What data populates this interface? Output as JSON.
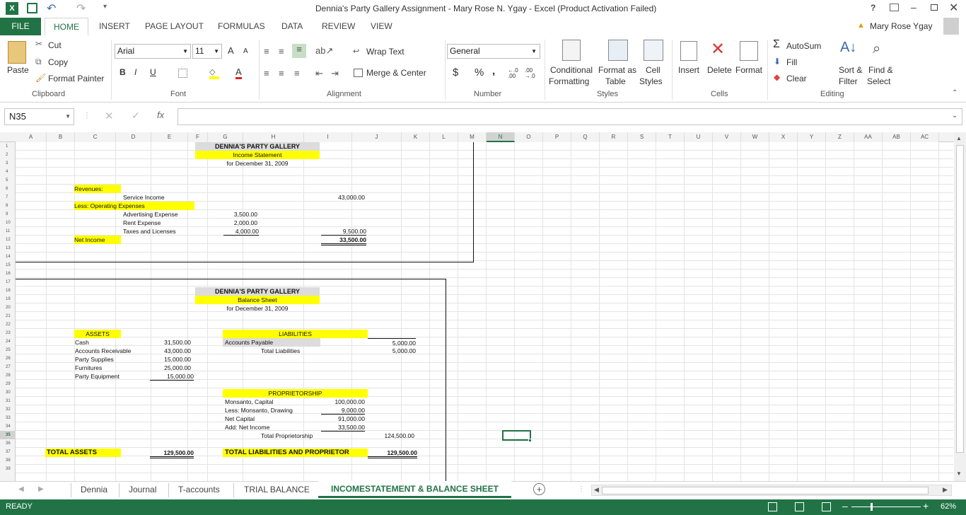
{
  "window": {
    "title": "Dennia's Party Gallery Assignment - Mary Rose N. Ygay - Excel (Product Activation Failed)",
    "help": "?",
    "user": "Mary Rose Ygay"
  },
  "tabs": [
    "FILE",
    "HOME",
    "INSERT",
    "PAGE LAYOUT",
    "FORMULAS",
    "DATA",
    "REVIEW",
    "VIEW"
  ],
  "ribbon": {
    "clipboard": {
      "paste": "Paste",
      "cut": "Cut",
      "copy": "Copy",
      "format_painter": "Format Painter",
      "group": "Clipboard"
    },
    "font": {
      "name": "Arial",
      "size": "11",
      "group": "Font",
      "bold": "B",
      "italic": "I",
      "underline": "U",
      "grow": "A",
      "shrink": "A",
      "font_color": "A"
    },
    "alignment": {
      "wrap": "Wrap Text",
      "merge": "Merge & Center",
      "group": "Alignment"
    },
    "number": {
      "format": "General",
      "currency": "$",
      "percent": "%",
      "comma": ",",
      "inc_decimal": "←.0 .00",
      "dec_decimal": ".00 →.0",
      "group": "Number"
    },
    "styles": {
      "conditional": "Conditional",
      "conditional2": "Formatting",
      "format_as": "Format as",
      "format_as2": "Table",
      "cell_styles": "Cell",
      "cell_styles2": "Styles",
      "group": "Styles"
    },
    "cells": {
      "insert": "Insert",
      "delete": "Delete",
      "format": "Format",
      "group": "Cells"
    },
    "editing": {
      "autosum": "AutoSum",
      "fill": "Fill",
      "clear": "Clear",
      "sort": "Sort &",
      "sort2": "Filter",
      "find": "Find &",
      "find2": "Select",
      "group": "Editing"
    }
  },
  "formula_bar": {
    "name_box": "N35",
    "fx": "fx",
    "value": ""
  },
  "columns": [
    "A",
    "B",
    "C",
    "D",
    "E",
    "F",
    "G",
    "H",
    "I",
    "J",
    "K",
    "L",
    "M",
    "N",
    "O",
    "P",
    "Q",
    "R",
    "S",
    "T",
    "U",
    "V",
    "W",
    "X",
    "Y",
    "Z",
    "AA",
    "AB",
    "AC"
  ],
  "rows": [
    "1",
    "2",
    "3",
    "4",
    "5",
    "6",
    "7",
    "8",
    "9",
    "10",
    "11",
    "12",
    "13",
    "14",
    "15",
    "16",
    "17",
    "18",
    "19",
    "20",
    "21",
    "22",
    "23",
    "24",
    "25",
    "26",
    "27",
    "28",
    "29",
    "30",
    "31",
    "32",
    "33",
    "34",
    "35",
    "36",
    "37",
    "38",
    "39"
  ],
  "income": {
    "company": "DENNIA'S PARTY GALLERY",
    "title": "Income Statement",
    "period": "for December 31, 2009",
    "revenues": "Revenues:",
    "service_income": "Service Income",
    "service_income_amt": "43,000.00",
    "less_opex": "Less: Operating Expenses",
    "advertising": "Advertising Expense",
    "advertising_amt": "3,500.00",
    "rent": "Rent Expense",
    "rent_amt": "2,000.00",
    "taxes": "Taxes and Licenses",
    "taxes_amt": "4,000.00",
    "total_exp": "9,500.00",
    "net_income": "Net Income",
    "net_income_amt": "33,500.00"
  },
  "balance": {
    "company": "DENNIA'S PARTY GALLERY",
    "title": "Balance Sheet",
    "period": "for December 31, 2009",
    "assets": "ASSETS",
    "cash": "Cash",
    "cash_amt": "31,500.00",
    "ar": "Accounts Receivable",
    "ar_amt": "43,000.00",
    "supplies": "Party Supplies",
    "supplies_amt": "15,000.00",
    "furnitures": "Furnitures",
    "furnitures_amt": "25,000.00",
    "equipment": "Party Equipment",
    "equipment_amt": "15,000.00",
    "liabilities": "LIABILITIES",
    "ap": "Accounts Payable",
    "ap_amt": "5,000.00",
    "total_liab": "Total Liabilities",
    "total_liab_amt": "5,000.00",
    "proprietorship": "PROPRIETORSHIP",
    "capital": "Monsanto, Capital",
    "capital_amt": "100,000.00",
    "drawing": "Less: Monsanto, Drawing",
    "drawing_amt": "9,000.00",
    "net_capital": "Net Capital",
    "net_capital_amt": "91,000.00",
    "add_ni": "Add: Net Income",
    "add_ni_amt": "33,500.00",
    "total_prop": "Total Proprietorship",
    "total_prop_amt": "124,500.00",
    "total_assets": "TOTAL ASSETS",
    "total_assets_amt": "129,500.00",
    "total_lp": "TOTAL LIABILITIES AND PROPRIETOR",
    "total_lp_amt": "129,500.00"
  },
  "sheets": [
    "Dennia",
    "Journal",
    "T-accounts",
    "TRIAL BALANCE",
    "INCOMESTATEMENT & BALANCE SHEET"
  ],
  "status": {
    "ready": "READY",
    "zoom": "62%"
  },
  "colors": {
    "excel_green": "#217346",
    "highlight": "#ffff00",
    "header_gray": "#dcdcdc"
  }
}
